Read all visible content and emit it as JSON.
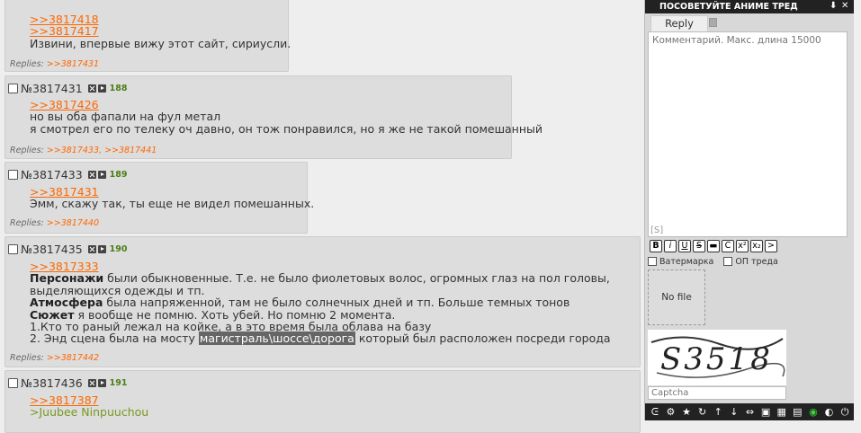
{
  "posts": [
    {
      "id": "p0",
      "lines": [],
      "links": [
        ">>3817418",
        ">>3817417"
      ],
      "text": "Извини, впервые вижу этот сайт, сириусли.",
      "replies_label": "Replies:",
      "replies": [
        ">>3817431"
      ]
    },
    {
      "id": "p1",
      "number": "№3817431",
      "count": "188",
      "link": ">>3817426",
      "lines": [
        "но вы оба фапали на фул метал",
        "я смотрел его по телеку оч давно, он тож понравился, но я же не такой помешанный"
      ],
      "replies_label": "Replies:",
      "replies": [
        ">>3817433,",
        ">>3817441"
      ]
    },
    {
      "id": "p2",
      "number": "№3817433",
      "count": "189",
      "link": ">>3817431",
      "lines": [
        "Эмм, скажу так, ты еще не видел помешанных."
      ],
      "replies_label": "Replies:",
      "replies": [
        ">>3817440"
      ]
    },
    {
      "id": "p3",
      "number": "№3817435",
      "count": "190",
      "link": ">>3817333",
      "b1": "Персонажи",
      "t1": " были обыкновенные. Т.е. не было фиолетовых волос, огромных глаз на пол головы,",
      "t1b": "выделяющихся одежды и тп.",
      "b2": "Атмосфера",
      "t2": " была напряженной, там не было солнечных дней и тп. Больше темных тонов",
      "b3": "Сюжет",
      "t3": " я вообще не помню. Хоть убей. Но помню 2 момента.",
      "l4": "1.Кто то раный лежал на койке, а в это время была облава на базу",
      "l5a": "2. Энд сцена была на мосту ",
      "l5h": "магистраль\\шоссе\\дорога",
      "l5b": " который был расположен посреди города",
      "replies_label": "Replies:",
      "replies": [
        ">>3817442"
      ]
    },
    {
      "id": "p4",
      "number": "№3817436",
      "count": "191",
      "link": ">>3817387",
      "green": ">Juubee Ninpuuchou"
    }
  ],
  "panel": {
    "title": "ПОСОВЕТУЙТЕ АНИМЕ ТРЕД",
    "pin": "⬇",
    "close": "✕",
    "tab_reply": "Reply",
    "comment_placeholder": "Комментарий. Макс. длина 15000",
    "spoiler_mark": "[S]",
    "format_buttons": [
      "B",
      "i",
      "U",
      "S",
      "▬",
      "C",
      "x²",
      "x₂",
      ">"
    ],
    "watermark_label": "Ватермарка",
    "op_label": "ОП треда",
    "nofile_label": "No file",
    "captcha_placeholder": "Captcha",
    "captcha_text": "S3518"
  },
  "toolbar_icons": [
    "logo-icon",
    "settings-icon",
    "star-icon",
    "refresh-icon",
    "arrow-up-icon",
    "arrow-down-icon",
    "expand-icon",
    "images-icon",
    "gallery-icon",
    "save-icon",
    "eye-icon",
    "brightness-icon",
    "power-icon"
  ],
  "colors": {
    "link": "#ff6600",
    "post_bg": "#dddddd",
    "page_bg": "#eeeeee",
    "count": "#4a7f1a",
    "greentext": "#789922"
  }
}
